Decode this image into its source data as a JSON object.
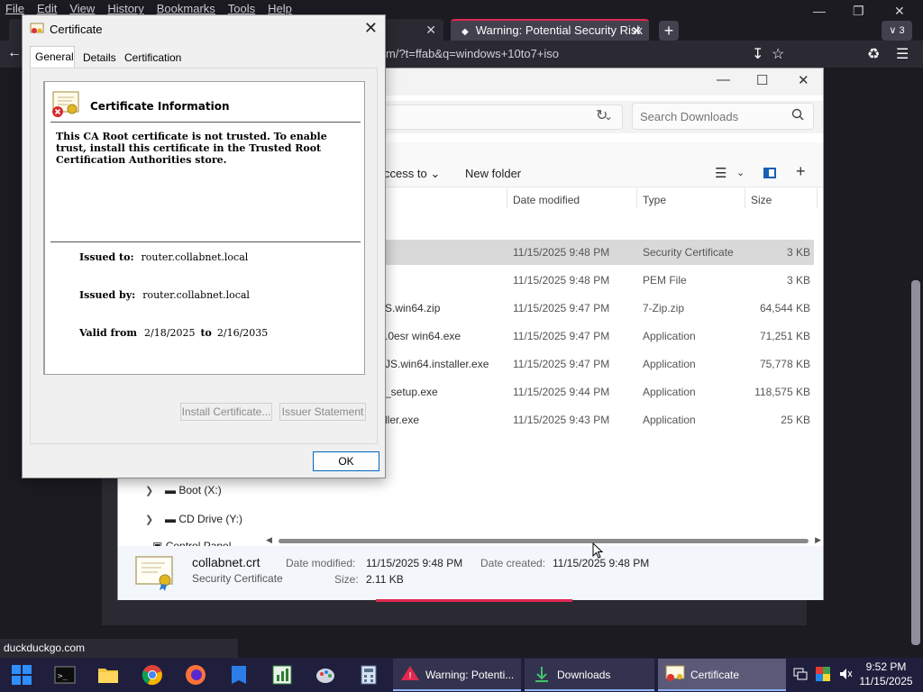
{
  "browser": {
    "menu": [
      "File",
      "Edit",
      "View",
      "History",
      "Bookmarks",
      "Tools",
      "Help"
    ],
    "tab_active_title": "Warning: Potential Security Risk",
    "tab_count": "3",
    "url": "m/?t=ffab&q=windows+10to7+iso",
    "status_url": "duckduckgo.com"
  },
  "explorer": {
    "search_placeholder": "Search Downloads",
    "toolbar_access": "ccess to",
    "toolbar_new_folder": "New folder",
    "columns": {
      "date": "Date modified",
      "type": "Type",
      "size": "Size"
    },
    "rows": [
      {
        "name": "",
        "date": "11/15/2025 9:48 PM",
        "type": "Security Certificate",
        "size": "3 KB",
        "selected": true
      },
      {
        "name": "",
        "date": "11/15/2025 9:48 PM",
        "type": "PEM File",
        "size": "3 KB",
        "selected": false
      },
      {
        "name": "S.win64.zip",
        "date": "11/15/2025 9:47 PM",
        "type": "7-Zip.zip",
        "size": "64,544 KB",
        "selected": false
      },
      {
        "name": ".0esr win64.exe",
        "date": "11/15/2025 9:47 PM",
        "type": "Application",
        "size": "71,251 KB",
        "selected": false
      },
      {
        "name": "JS.win64.installer.exe",
        "date": "11/15/2025 9:47 PM",
        "type": "Application",
        "size": "75,778 KB",
        "selected": false
      },
      {
        "name": "_setup.exe",
        "date": "11/15/2025 9:44 PM",
        "type": "Application",
        "size": "118,575 KB",
        "selected": false
      },
      {
        "name": "ller.exe",
        "date": "11/15/2025 9:43 PM",
        "type": "Application",
        "size": "25 KB",
        "selected": false
      }
    ],
    "nav": [
      {
        "label": "Boot (X:)"
      },
      {
        "label": "CD Drive (Y:)"
      },
      {
        "label": "Control Panel"
      }
    ],
    "details": {
      "file_name": "collabnet.crt",
      "file_type": "Security Certificate",
      "date_modified_label": "Date modified:",
      "date_modified": "11/15/2025 9:48 PM",
      "date_created_label": "Date created:",
      "date_created": "11/15/2025 9:48 PM",
      "size_label": "Size:",
      "size": "2.11 KB"
    }
  },
  "certificate": {
    "title": "Certificate",
    "tabs": [
      "General",
      "Details",
      "Certification Path"
    ],
    "heading": "Certificate Information",
    "warning": "This CA Root certificate is not trusted. To enable trust, install this certificate in the Trusted Root Certification Authorities store.",
    "issued_to_label": "Issued to:",
    "issued_to": "router.collabnet.local",
    "issued_by_label": "Issued by:",
    "issued_by": "router.collabnet.local",
    "valid_from_label": "Valid from",
    "valid_from": "2/18/2025",
    "valid_to_label": "to",
    "valid_to": "2/16/2035",
    "install_button": "Install Certificate...",
    "issuer_button": "Issuer Statement",
    "ok_button": "OK"
  },
  "taskbar": {
    "tasks": [
      "Warning: Potenti...",
      "Downloads",
      "Certificate"
    ],
    "time": "9:52 PM",
    "date": "11/15/2025"
  }
}
